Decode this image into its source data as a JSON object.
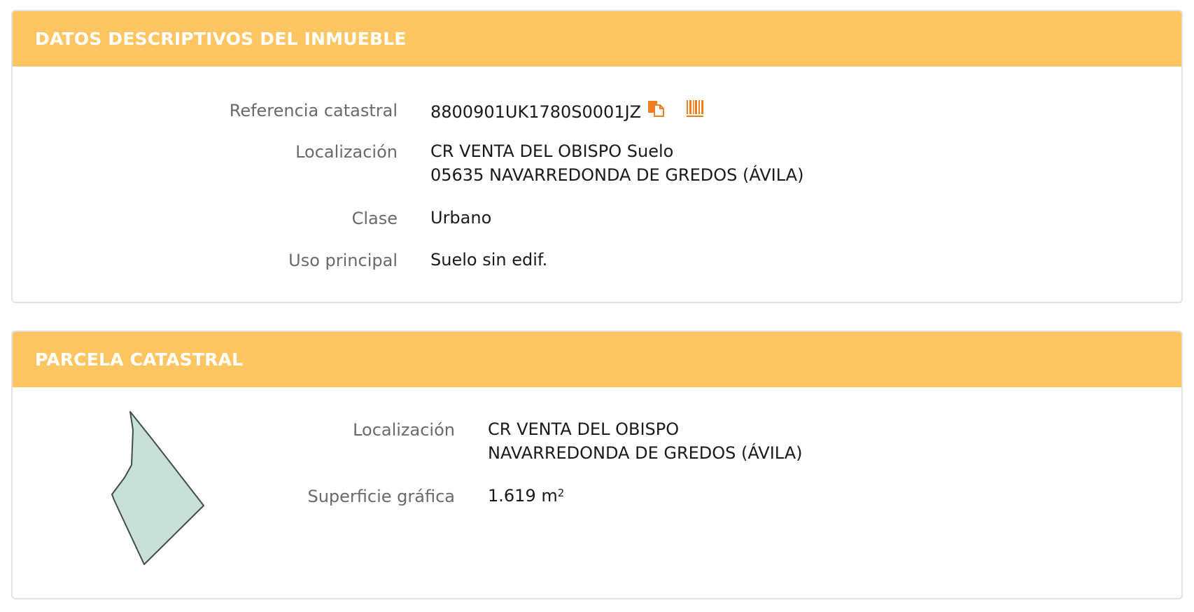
{
  "datos": {
    "title": "DATOS DESCRIPTIVOS DEL INMUEBLE",
    "referencia_label": "Referencia catastral",
    "referencia_value": "8800901UK1780S0001JZ",
    "localizacion_label": "Localización",
    "localizacion_line1": "CR VENTA DEL OBISPO Suelo",
    "localizacion_line2": "05635 NAVARREDONDA DE GREDOS (ÁVILA)",
    "clase_label": "Clase",
    "clase_value": "Urbano",
    "uso_label": "Uso principal",
    "uso_value": "Suelo sin edif."
  },
  "parcela": {
    "title": "PARCELA CATASTRAL",
    "localizacion_label": "Localización",
    "localizacion_line1": "CR VENTA DEL OBISPO",
    "localizacion_line2": "NAVARREDONDA DE GREDOS (ÁVILA)",
    "superficie_label": "Superficie gráfica",
    "superficie_value": "1.619 m",
    "superficie_unit_sup": "2"
  },
  "colors": {
    "header_bg": "#fdc663",
    "icon_orange": "#ee7f1e",
    "parcel_fill": "#c8e0d8",
    "parcel_stroke": "#3f4f45"
  },
  "icons": {
    "copy": "copy-icon",
    "barcode": "barcode-icon"
  }
}
